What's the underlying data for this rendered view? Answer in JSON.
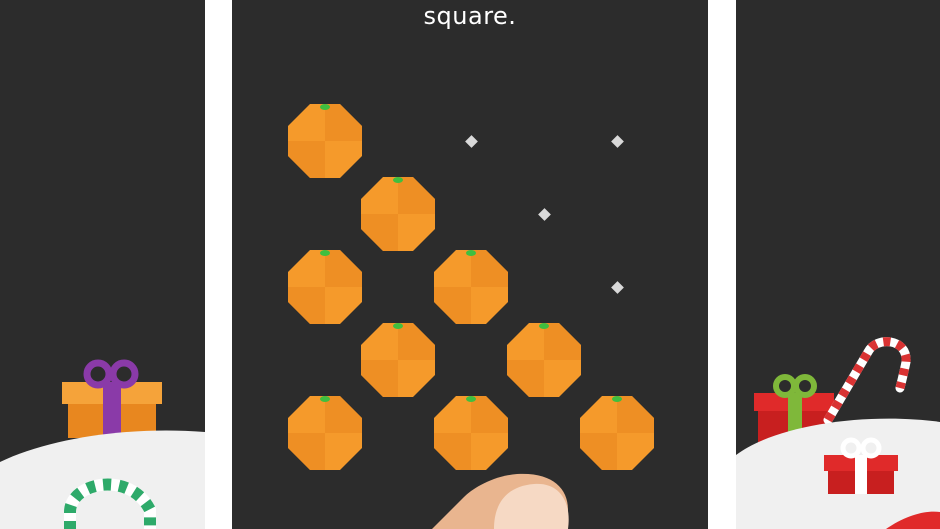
{
  "caption": {
    "text": "square."
  },
  "board": {
    "rows": [
      [
        "orange",
        "empty",
        "dot",
        "empty",
        "dot"
      ],
      [
        "empty",
        "orange",
        "empty",
        "dot",
        "empty"
      ],
      [
        "orange",
        "empty",
        "orange",
        "empty",
        "dot"
      ],
      [
        "empty",
        "orange",
        "empty",
        "orange",
        "empty"
      ],
      [
        "orange",
        "empty",
        "orange",
        "empty",
        "orange"
      ]
    ],
    "orange_count": 9,
    "dot_count": 4
  },
  "decorations": {
    "left_panel": [
      "gift-box-purple-ribbon",
      "candy-cane-green",
      "snow-hill"
    ],
    "center_panel": [
      "finger-pointer"
    ],
    "right_panel": [
      "gift-box-green-ribbon",
      "gift-box-white-ribbon",
      "candy-cane-red",
      "snow-hill"
    ]
  },
  "colors": {
    "background_panel": "#2c2c2c",
    "orange": "#f59a2b",
    "orange_shade": "#e8871f",
    "leaf": "#3fbf3f",
    "dot": "#d9d9d9",
    "snow": "#f0f0f0",
    "gift_orange": "#f39a23",
    "gift_red": "#e02a2a",
    "ribbon_purple": "#8a3aa8",
    "ribbon_green": "#7fb83a",
    "candy_red": "#d93333",
    "candy_green": "#2eaa6a"
  }
}
